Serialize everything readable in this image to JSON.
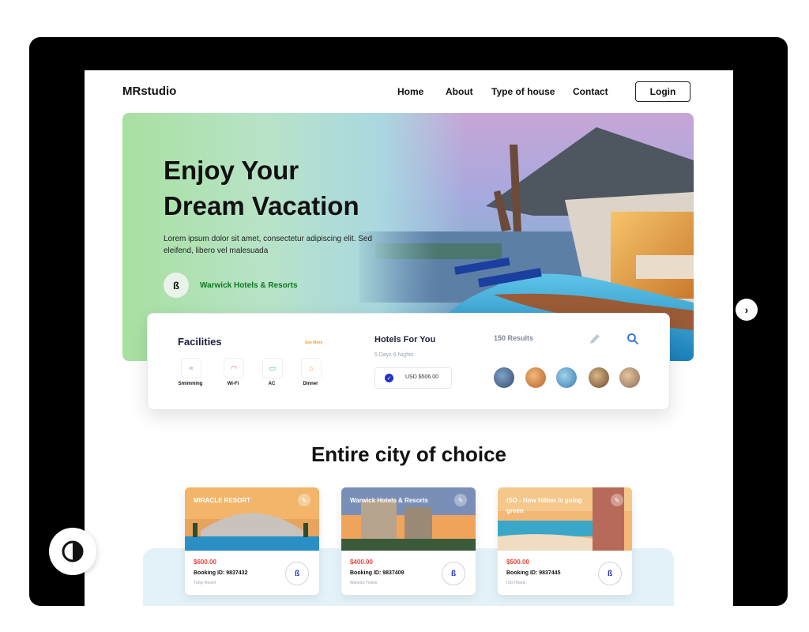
{
  "nav": {
    "logo": "MRstudio",
    "links": [
      "Home",
      "About",
      "Type of house",
      "Contact"
    ],
    "login": "Login"
  },
  "hero": {
    "title_line1": "Enjoy Your",
    "title_line2": "Dream Vacation",
    "description": "Lorem ipsum dolor sit amet, consectetur adipiscing elit. Sed eleifend, libero vel malesuada",
    "brand_name": "Warwick Hotels & Resorts"
  },
  "facilities": {
    "title": "Facilities",
    "see_more": "See More",
    "items": [
      {
        "label": "Smimming",
        "icon": "swimming-icon"
      },
      {
        "label": "Wi-Fi",
        "icon": "wifi-icon"
      },
      {
        "label": "AC",
        "icon": "ac-icon"
      },
      {
        "label": "Dinner",
        "icon": "dinner-icon"
      }
    ]
  },
  "hotels_for_you": {
    "title": "Hotels For You",
    "subtitle": "5 Days 6 Nights",
    "price": "USD $506.00"
  },
  "results": {
    "count_label": "150 Results"
  },
  "section": {
    "title": "Entire city of choice"
  },
  "resorts": [
    {
      "name": "MIRACLE RESORT",
      "price": "$600.00",
      "booking": "Booking ID: 9837432",
      "sub": "Turky Resort"
    },
    {
      "name": "Warwick Hotels & Resorts",
      "price": "$400.00",
      "booking": "Booking ID: 9837409",
      "sub": "Warwick Hotels"
    },
    {
      "name": "ISO - How Hilton is going green",
      "price": "$500.00",
      "booking": "Booking ID: 9837445",
      "sub": "ISO Hotels"
    }
  ],
  "colors": {
    "accent": "#2331c9",
    "price_red": "#e8443e",
    "brand_green": "#0b7a1e"
  }
}
